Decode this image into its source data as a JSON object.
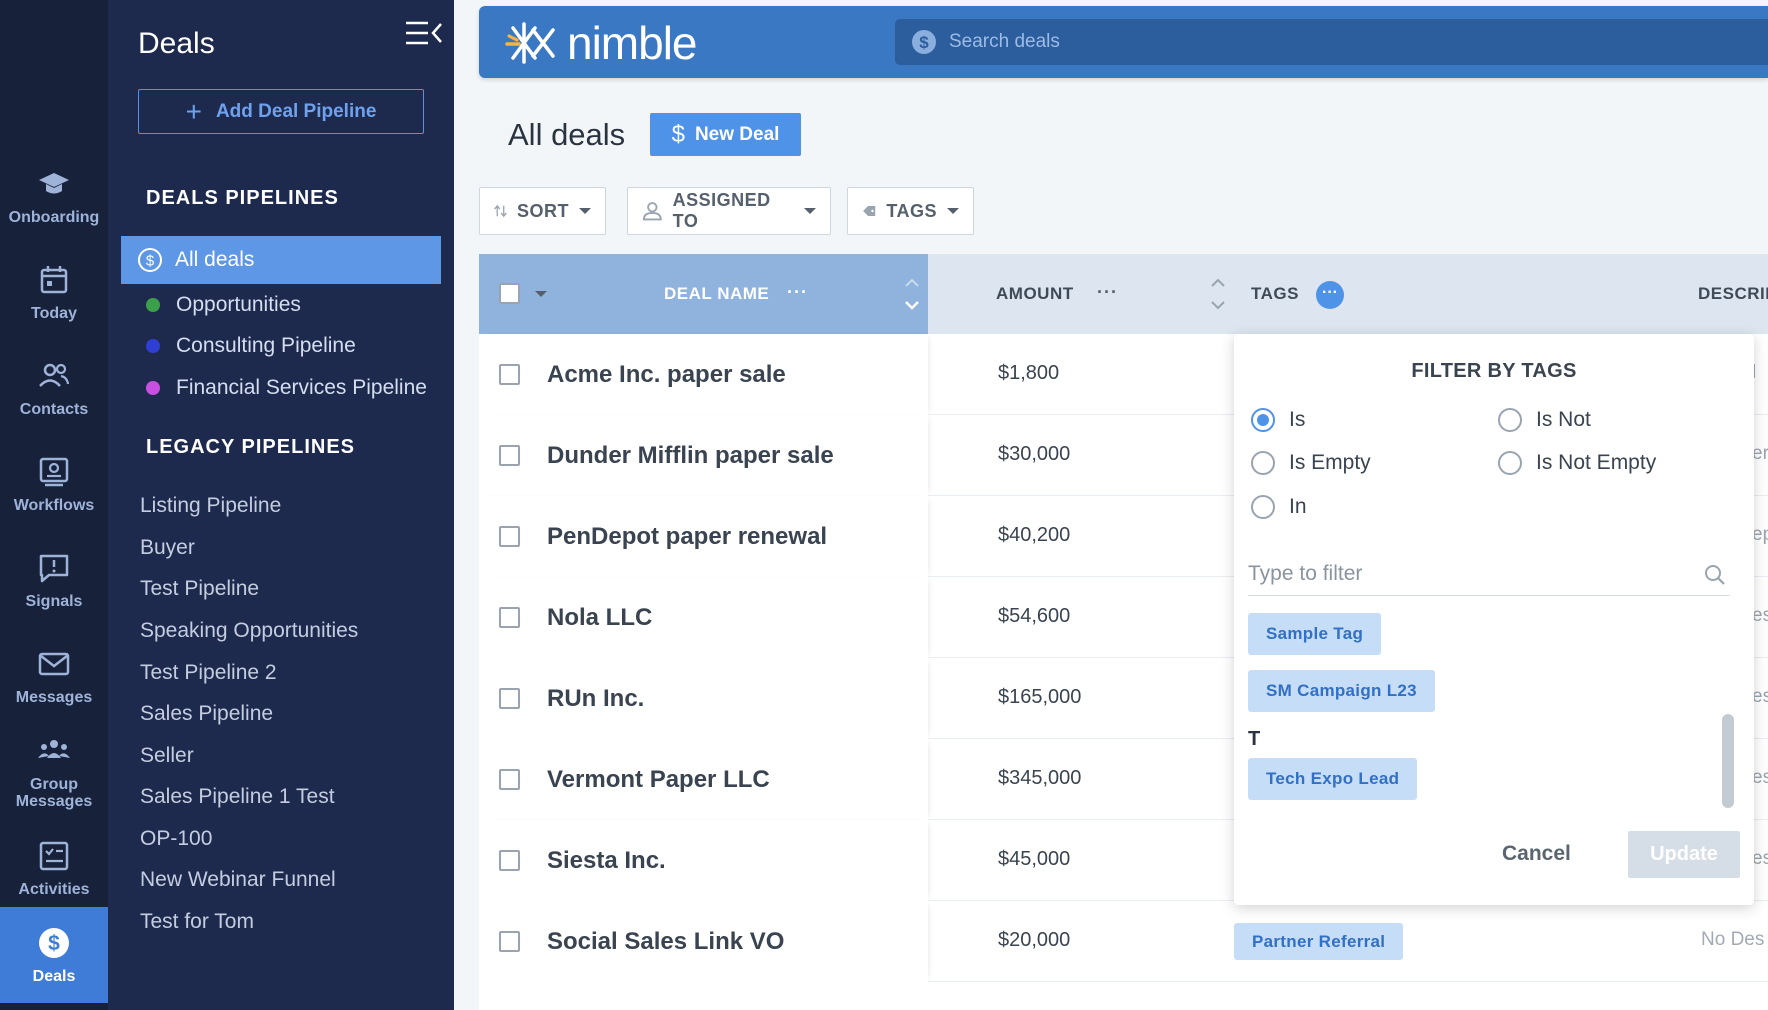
{
  "rail": {
    "items": [
      {
        "label": "Onboarding",
        "icon": "graduation-cap-icon"
      },
      {
        "label": "Today",
        "icon": "calendar-icon"
      },
      {
        "label": "Contacts",
        "icon": "people-icon"
      },
      {
        "label": "Workflows",
        "icon": "workflow-icon"
      },
      {
        "label": "Signals",
        "icon": "signal-message-icon"
      },
      {
        "label": "Messages",
        "icon": "envelope-icon"
      },
      {
        "label": "Group Messages",
        "icon": "group-icon"
      },
      {
        "label": "Activities",
        "icon": "activities-icon"
      },
      {
        "label": "Deals",
        "icon": "dollar-circle-icon"
      }
    ]
  },
  "sidebar": {
    "title": "Deals",
    "add_pipeline_label": "Add Deal Pipeline",
    "deals_pipelines_heading": "DEALS PIPELINES",
    "active_pipeline": "All deals",
    "pipelines": [
      {
        "label": "Opportunities",
        "color": "#3aa14a"
      },
      {
        "label": "Consulting Pipeline",
        "color": "#2f3fd6"
      },
      {
        "label": "Financial Services Pipeline",
        "color": "#c84fe0"
      }
    ],
    "legacy_heading": "LEGACY PIPELINES",
    "legacy": [
      "Listing Pipeline",
      "Buyer",
      "Test Pipeline",
      "Speaking Opportunities",
      "Test Pipeline 2",
      "Sales Pipeline",
      "Seller",
      "Sales Pipeline 1 Test",
      "OP-100",
      "New Webinar Funnel",
      "Test for Tom"
    ]
  },
  "header": {
    "logo_text": "nimble",
    "search_placeholder": "Search deals"
  },
  "page": {
    "title": "All deals",
    "new_deal_label": "New Deal",
    "sort_label": "SORT",
    "assigned_label": "ASSIGNED TO",
    "tags_label": "TAGS"
  },
  "table": {
    "col_deal": "DEAL NAME",
    "col_amount": "AMOUNT",
    "col_tags": "TAGS",
    "col_desc": "DESCRIP",
    "dots": "···",
    "rows": [
      {
        "name": "Acme Inc. paper sale",
        "amount": "$1,800",
        "desc": "l"
      },
      {
        "name": "Dunder Mifflin paper sale",
        "amount": "$30,000",
        "desc": "er"
      },
      {
        "name": "PenDepot paper renewal",
        "amount": "$40,200",
        "desc": "ep"
      },
      {
        "name": "Nola LLC",
        "amount": "$54,600",
        "desc": "es"
      },
      {
        "name": "RUn Inc.",
        "amount": "$165,000",
        "desc": "es"
      },
      {
        "name": "Vermont Paper LLC",
        "amount": "$345,000",
        "desc": "es"
      },
      {
        "name": "Siesta Inc.",
        "amount": "$45,000",
        "desc": "es"
      },
      {
        "name": "Social Sales Link VO",
        "amount": "$20,000",
        "tag": "Partner Referral",
        "desc": "No Des"
      }
    ]
  },
  "popover": {
    "title": "FILTER BY TAGS",
    "options": {
      "is": "Is",
      "is_not": "Is Not",
      "is_empty": "Is Empty",
      "is_not_empty": "Is Not Empty",
      "in": "In"
    },
    "selected_option": "Is",
    "filter_placeholder": "Type to filter",
    "tags": [
      "Sample Tag",
      "SM Campaign L23",
      "Tech Expo Lead"
    ],
    "letter_t": "T",
    "cancel_label": "Cancel",
    "update_label": "Update"
  },
  "colors": {
    "accent": "#4f93e8",
    "rail_bg": "#17213a",
    "sidebar_bg": "#1e2a4d",
    "header_bg": "#3b78c4"
  }
}
